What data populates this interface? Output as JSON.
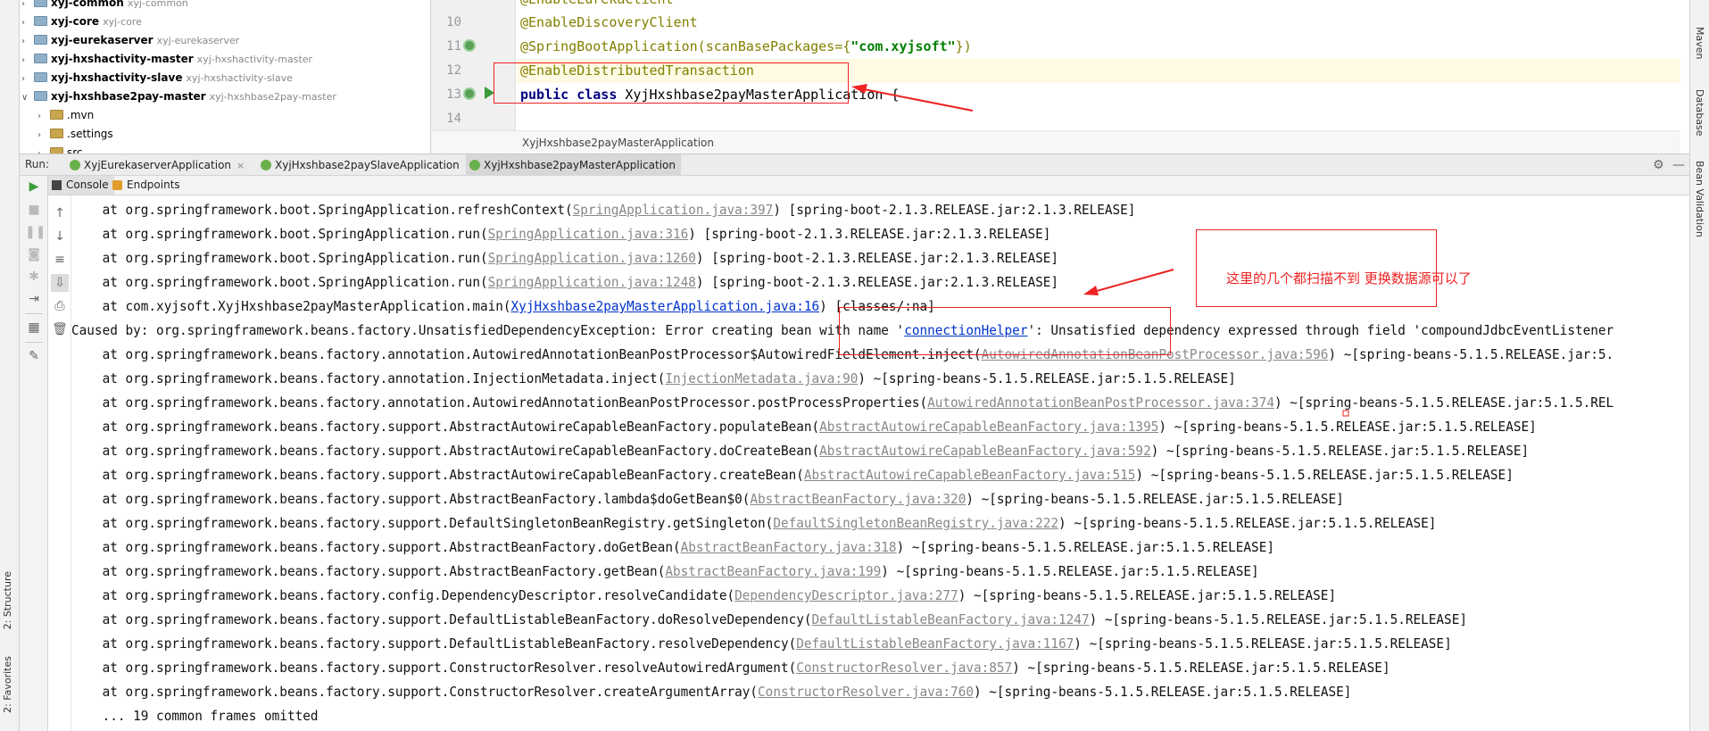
{
  "project_tree": {
    "items": [
      {
        "name": "xyj-common",
        "module": "xyj-common",
        "expanded": false,
        "indent": 0
      },
      {
        "name": "xyj-core",
        "module": "xyj-core",
        "expanded": false,
        "indent": 0
      },
      {
        "name": "xyj-eurekaserver",
        "module": "xyj-eurekaserver",
        "expanded": false,
        "indent": 0
      },
      {
        "name": "xyj-hxshactivity-master",
        "module": "xyj-hxshactivity-master",
        "expanded": false,
        "indent": 0
      },
      {
        "name": "xyj-hxshactivity-slave",
        "module": "xyj-hxshactivity-slave",
        "expanded": false,
        "indent": 0
      },
      {
        "name": "xyj-hxshbase2pay-master",
        "module": "xyj-hxshbase2pay-master",
        "expanded": true,
        "indent": 0
      },
      {
        "name": ".mvn",
        "module": "",
        "expanded": false,
        "indent": 1
      },
      {
        "name": ".settings",
        "module": "",
        "expanded": false,
        "indent": 1
      },
      {
        "name": "src",
        "module": "",
        "expanded": false,
        "indent": 1
      }
    ]
  },
  "editor": {
    "lines": [
      {
        "num": "10",
        "text": "@EnableDiscoveryClient"
      },
      {
        "num": "11",
        "text_parts": [
          "@SpringBootApplication(scanBasePackages={",
          "\"com.xyjsoft\"",
          "})"
        ]
      },
      {
        "num": "12",
        "text": "@EnableDistributedTransaction"
      },
      {
        "num": "13",
        "text_parts": [
          "public class ",
          "XyjHxshbase2payMasterApplication {"
        ]
      },
      {
        "num": "14",
        "text": ""
      }
    ],
    "top_partial_line": "@EnableEurekaClient",
    "breadcrumb": "XyjHxshbase2payMasterApplication"
  },
  "run_bar": {
    "label": "Run:",
    "tabs": [
      {
        "label": "XyjEurekaserverApplication",
        "active": false
      },
      {
        "label": "XyjHxshbase2paySlaveApplication",
        "active": false
      },
      {
        "label": "XyjHxshbase2payMasterApplication",
        "active": true
      }
    ]
  },
  "console_tabs": {
    "console": "Console",
    "endpoints": "Endpoints"
  },
  "side_tabs": {
    "structure": "2: Structure",
    "favorites": "2: Favorites",
    "maven": "Maven",
    "database": "Database",
    "bean_validation": "Bean Validation"
  },
  "console": {
    "lines": [
      {
        "prefix": "    at org.springframework.boot.SpringApplication.refreshContext(",
        "link": "SpringApplication.java:397",
        "suffix": ") [spring-boot-2.1.3.RELEASE.jar:2.1.3.RELEASE]"
      },
      {
        "prefix": "    at org.springframework.boot.SpringApplication.run(",
        "link": "SpringApplication.java:316",
        "suffix": ") [spring-boot-2.1.3.RELEASE.jar:2.1.3.RELEASE]"
      },
      {
        "prefix": "    at org.springframework.boot.SpringApplication.run(",
        "link": "SpringApplication.java:1260",
        "suffix": ") [spring-boot-2.1.3.RELEASE.jar:2.1.3.RELEASE]"
      },
      {
        "prefix": "    at org.springframework.boot.SpringApplication.run(",
        "link": "SpringApplication.java:1248",
        "suffix": ") [spring-boot-2.1.3.RELEASE.jar:2.1.3.RELEASE]"
      },
      {
        "prefix": "    at com.xyjsoft.XyjHxshbase2payMasterApplication.main(",
        "link": "XyjHxshbase2payMasterApplication.java:16",
        "suffix": ") [classes/:na]",
        "blue": true
      },
      {
        "prefix": "Caused by: org.springframework.beans.factory.UnsatisfiedDependencyException: Error creating bean with name '",
        "link": "connectionHelper",
        "suffix": "': Unsatisfied dependency expressed through field 'compoundJdbcEventListener",
        "blue": true
      },
      {
        "prefix": "    at org.springframework.beans.factory.annotation.AutowiredAnnotationBeanPostProcessor$AutowiredFieldElement.inject(",
        "link": "AutowiredAnnotationBeanPostProcessor.java:596",
        "suffix": ") ~[spring-beans-5.1.5.RELEASE.jar:5."
      },
      {
        "prefix": "    at org.springframework.beans.factory.annotation.InjectionMetadata.inject(",
        "link": "InjectionMetadata.java:90",
        "suffix": ") ~[spring-beans-5.1.5.RELEASE.jar:5.1.5.RELEASE]"
      },
      {
        "prefix": "    at org.springframework.beans.factory.annotation.AutowiredAnnotationBeanPostProcessor.postProcessProperties(",
        "link": "AutowiredAnnotationBeanPostProcessor.java:374",
        "suffix": ") ~[spring-beans-5.1.5.RELEASE.jar:5.1.5.REL"
      },
      {
        "prefix": "    at org.springframework.beans.factory.support.AbstractAutowireCapableBeanFactory.populateBean(",
        "link": "AbstractAutowireCapableBeanFactory.java:1395",
        "suffix": ") ~[spring-beans-5.1.5.RELEASE.jar:5.1.5.RELEASE]"
      },
      {
        "prefix": "    at org.springframework.beans.factory.support.AbstractAutowireCapableBeanFactory.doCreateBean(",
        "link": "AbstractAutowireCapableBeanFactory.java:592",
        "suffix": ") ~[spring-beans-5.1.5.RELEASE.jar:5.1.5.RELEASE]"
      },
      {
        "prefix": "    at org.springframework.beans.factory.support.AbstractAutowireCapableBeanFactory.createBean(",
        "link": "AbstractAutowireCapableBeanFactory.java:515",
        "suffix": ") ~[spring-beans-5.1.5.RELEASE.jar:5.1.5.RELEASE]"
      },
      {
        "prefix": "    at org.springframework.beans.factory.support.AbstractBeanFactory.lambda$doGetBean$0(",
        "link": "AbstractBeanFactory.java:320",
        "suffix": ") ~[spring-beans-5.1.5.RELEASE.jar:5.1.5.RELEASE]"
      },
      {
        "prefix": "    at org.springframework.beans.factory.support.DefaultSingletonBeanRegistry.getSingleton(",
        "link": "DefaultSingletonBeanRegistry.java:222",
        "suffix": ") ~[spring-beans-5.1.5.RELEASE.jar:5.1.5.RELEASE]"
      },
      {
        "prefix": "    at org.springframework.beans.factory.support.AbstractBeanFactory.doGetBean(",
        "link": "AbstractBeanFactory.java:318",
        "suffix": ") ~[spring-beans-5.1.5.RELEASE.jar:5.1.5.RELEASE]"
      },
      {
        "prefix": "    at org.springframework.beans.factory.support.AbstractBeanFactory.getBean(",
        "link": "AbstractBeanFactory.java:199",
        "suffix": ") ~[spring-beans-5.1.5.RELEASE.jar:5.1.5.RELEASE]"
      },
      {
        "prefix": "    at org.springframework.beans.factory.config.DependencyDescriptor.resolveCandidate(",
        "link": "DependencyDescriptor.java:277",
        "suffix": ") ~[spring-beans-5.1.5.RELEASE.jar:5.1.5.RELEASE]"
      },
      {
        "prefix": "    at org.springframework.beans.factory.support.DefaultListableBeanFactory.doResolveDependency(",
        "link": "DefaultListableBeanFactory.java:1247",
        "suffix": ") ~[spring-beans-5.1.5.RELEASE.jar:5.1.5.RELEASE]"
      },
      {
        "prefix": "    at org.springframework.beans.factory.support.DefaultListableBeanFactory.resolveDependency(",
        "link": "DefaultListableBeanFactory.java:1167",
        "suffix": ") ~[spring-beans-5.1.5.RELEASE.jar:5.1.5.RELEASE]"
      },
      {
        "prefix": "    at org.springframework.beans.factory.support.ConstructorResolver.resolveAutowiredArgument(",
        "link": "ConstructorResolver.java:857",
        "suffix": ") ~[spring-beans-5.1.5.RELEASE.jar:5.1.5.RELEASE]"
      },
      {
        "prefix": "    at org.springframework.beans.factory.support.ConstructorResolver.createArgumentArray(",
        "link": "ConstructorResolver.java:760",
        "suffix": ") ~[spring-beans-5.1.5.RELEASE.jar:5.1.5.RELEASE]"
      },
      {
        "prefix": "    ... 19 common frames omitted",
        "link": "",
        "suffix": ""
      }
    ]
  },
  "annotation": {
    "note": "这里的几个都扫描不到   更换数据源可以了",
    "color": "#e22222"
  }
}
